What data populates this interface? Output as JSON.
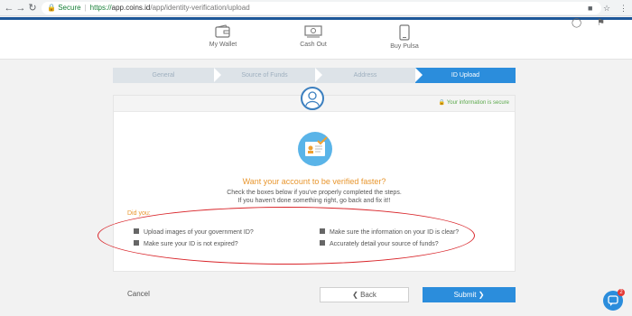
{
  "browser": {
    "secure_label": "Secure",
    "url_protocol": "https://",
    "url_host": "app.coins.id",
    "url_path": "/app/identity-verification/upload"
  },
  "topnav": {
    "items": [
      {
        "label": "My Wallet"
      },
      {
        "label": "Cash Out"
      },
      {
        "label": "Buy Pulsa"
      }
    ]
  },
  "steps": [
    {
      "label": "General"
    },
    {
      "label": "Source of Funds"
    },
    {
      "label": "Address"
    },
    {
      "label": "ID Upload"
    }
  ],
  "card": {
    "secure_note": "Your information is secure",
    "headline": "Want your account to be verified faster?",
    "desc_line1": "Check the boxes below if you've properly completed the steps.",
    "desc_line2": "If you haven't done something right, go back and fix it!!",
    "did_you": "Did you:",
    "checks": [
      {
        "label": "Upload images of your government ID?"
      },
      {
        "label": "Make sure your ID is not expired?"
      },
      {
        "label": "Make sure the information on your ID is clear?"
      },
      {
        "label": "Accurately detail your source of funds?"
      }
    ]
  },
  "footer": {
    "cancel": "Cancel",
    "back": "Back",
    "submit": "Submit"
  },
  "chat": {
    "badge": "2"
  },
  "colors": {
    "accent": "#2b8ddc",
    "highlight": "#e8962e",
    "annotation": "#d9262b"
  }
}
